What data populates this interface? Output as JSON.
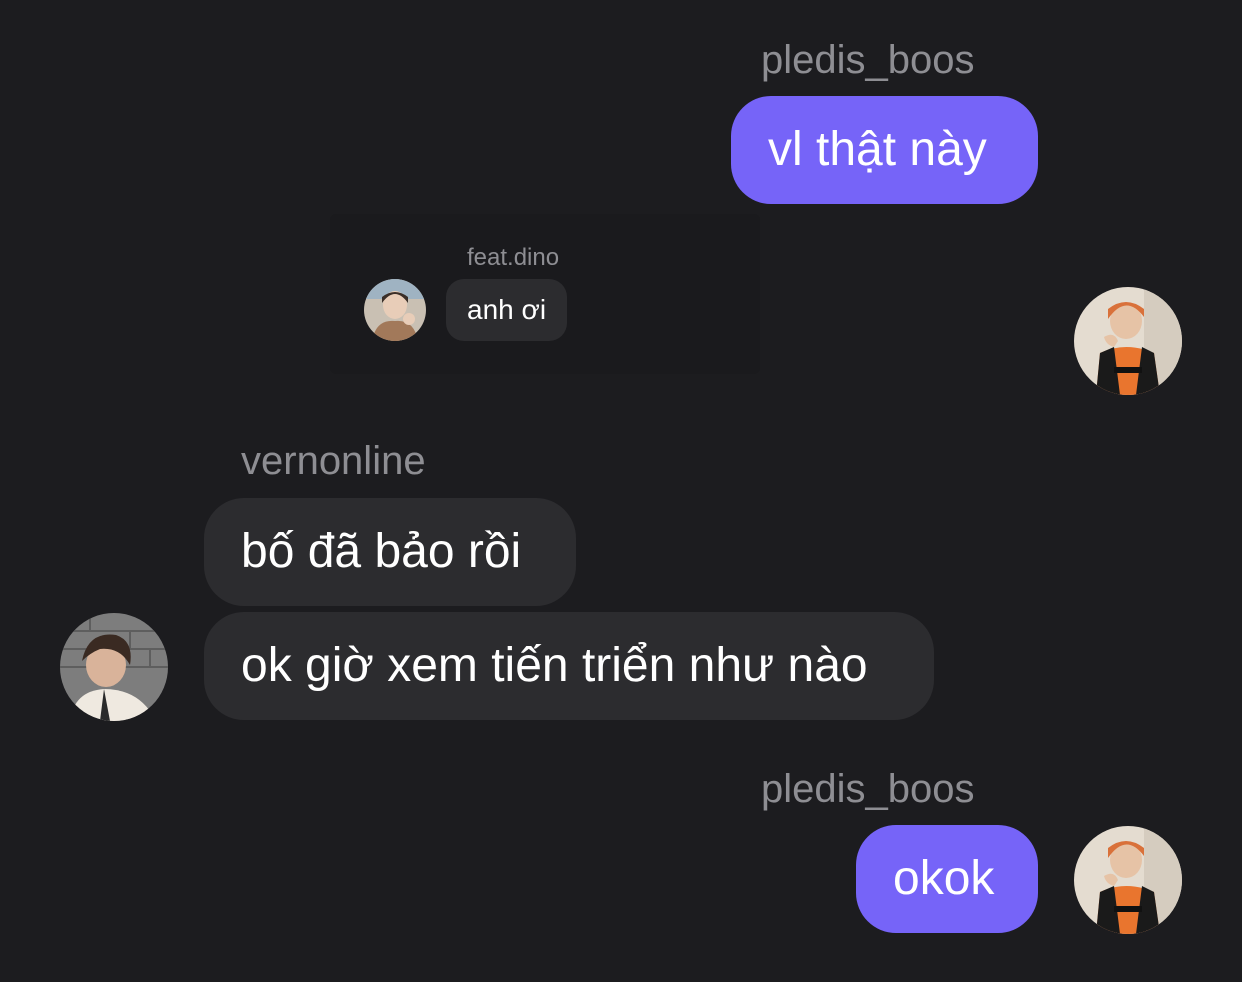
{
  "messages": [
    {
      "sender": "pledis_boos",
      "text": "vl thật này",
      "direction": "outgoing"
    },
    {
      "reply_sender": "feat.dino",
      "reply_text": "anh ơi"
    },
    {
      "sender": "vernonline",
      "texts": [
        "bố đã bảo rồi",
        "ok giờ xem tiến triển như nào"
      ],
      "direction": "incoming"
    },
    {
      "sender": "pledis_boos",
      "text": "okok",
      "direction": "outgoing"
    }
  ],
  "colors": {
    "background": "#1c1c1f",
    "outgoing_bubble": "#7664f8",
    "incoming_bubble": "#2c2c2f",
    "sender_name": "#8e8e93",
    "text": "#ffffff"
  },
  "icons": {
    "avatar_self": "orange-jersey-user-avatar",
    "avatar_vernon": "dark-hair-user-avatar",
    "avatar_dino": "small-user-avatar"
  }
}
